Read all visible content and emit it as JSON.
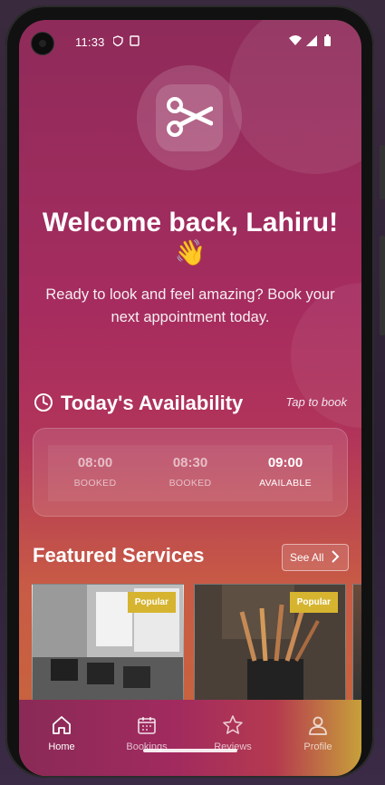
{
  "status_bar": {
    "time": "11:33"
  },
  "hero": {
    "title": "Welcome back, Lahiru!",
    "emoji": "👋",
    "subtitle": "Ready to look and feel amazing? Book your next appointment today."
  },
  "availability": {
    "title": "Today's Availability",
    "tap_label": "Tap to book",
    "slots": [
      {
        "time": "08:00",
        "status": "BOOKED"
      },
      {
        "time": "08:30",
        "status": "BOOKED"
      },
      {
        "time": "09:00",
        "status": "AVAILABLE"
      }
    ]
  },
  "featured": {
    "title": "Featured Services",
    "see_all": "See All",
    "cards": [
      {
        "badge": "Popular"
      },
      {
        "badge": "Popular"
      }
    ]
  },
  "bottom_nav": {
    "items": [
      {
        "label": "Home",
        "icon": "home-icon",
        "active": true
      },
      {
        "label": "Bookings",
        "icon": "calendar-icon",
        "active": false
      },
      {
        "label": "Reviews",
        "icon": "star-icon",
        "active": false
      },
      {
        "label": "Profile",
        "icon": "user-icon",
        "active": false
      }
    ]
  },
  "colors": {
    "primary": "#a62c5f",
    "accent": "#d6b42f"
  }
}
